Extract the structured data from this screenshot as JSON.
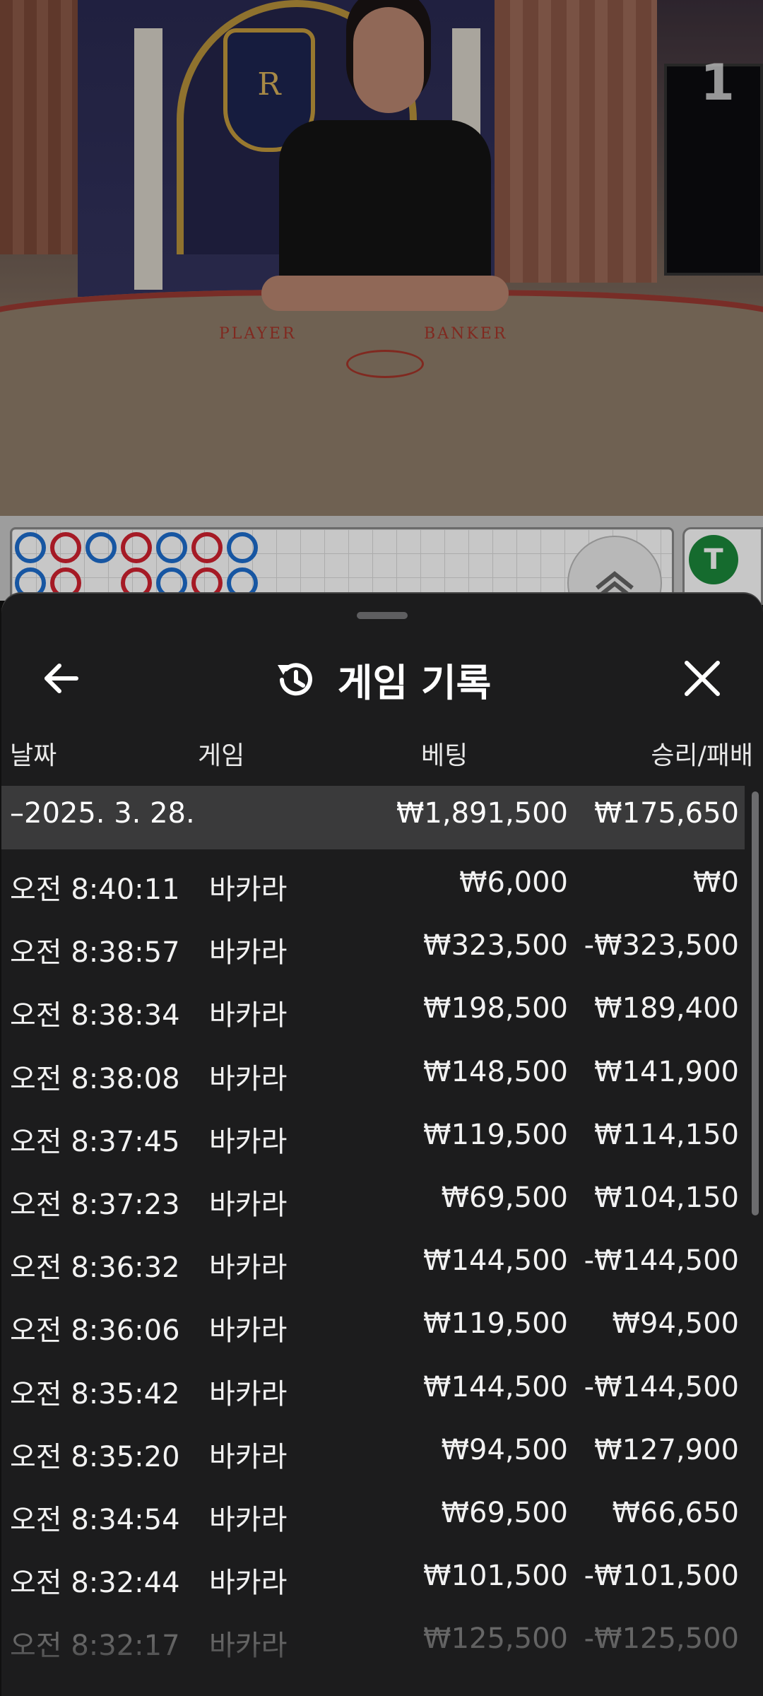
{
  "video": {
    "table_number": "1",
    "table_labels": {
      "player": "PLAYER",
      "banker": "BANKER"
    },
    "crest_letter": "R"
  },
  "road": {
    "side_badge": "T",
    "beads": [
      {
        "col": 0,
        "row": 0,
        "color": "b"
      },
      {
        "col": 1,
        "row": 0,
        "color": "r"
      },
      {
        "col": 2,
        "row": 0,
        "color": "b"
      },
      {
        "col": 3,
        "row": 0,
        "color": "r"
      },
      {
        "col": 4,
        "row": 0,
        "color": "b"
      },
      {
        "col": 5,
        "row": 0,
        "color": "r"
      },
      {
        "col": 6,
        "row": 0,
        "color": "b"
      },
      {
        "col": 0,
        "row": 1,
        "color": "b"
      },
      {
        "col": 1,
        "row": 1,
        "color": "r"
      },
      {
        "col": 3,
        "row": 1,
        "color": "r"
      },
      {
        "col": 4,
        "row": 1,
        "color": "b"
      },
      {
        "col": 5,
        "row": 1,
        "color": "r"
      },
      {
        "col": 6,
        "row": 1,
        "color": "b"
      }
    ]
  },
  "sheet": {
    "title": "게임 기록",
    "back_icon": "arrow-left-icon",
    "history_icon": "history-icon",
    "close_icon": "close-icon",
    "columns": {
      "date": "날짜",
      "game": "게임",
      "bet": "베팅",
      "win_loss": "승리/패배"
    },
    "summary": {
      "date": "–2025. 3. 28.",
      "bet": "₩1,891,500",
      "win_loss": "₩175,650"
    },
    "rows": [
      {
        "time": "오전 8:40:11",
        "game": "바카라",
        "bet": "₩6,000",
        "win_loss": "₩0"
      },
      {
        "time": "오전 8:38:57",
        "game": "바카라",
        "bet": "₩323,500",
        "win_loss": "-₩323,500"
      },
      {
        "time": "오전 8:38:34",
        "game": "바카라",
        "bet": "₩198,500",
        "win_loss": "₩189,400"
      },
      {
        "time": "오전 8:38:08",
        "game": "바카라",
        "bet": "₩148,500",
        "win_loss": "₩141,900"
      },
      {
        "time": "오전 8:37:45",
        "game": "바카라",
        "bet": "₩119,500",
        "win_loss": "₩114,150"
      },
      {
        "time": "오전 8:37:23",
        "game": "바카라",
        "bet": "₩69,500",
        "win_loss": "₩104,150"
      },
      {
        "time": "오전 8:36:32",
        "game": "바카라",
        "bet": "₩144,500",
        "win_loss": "-₩144,500"
      },
      {
        "time": "오전 8:36:06",
        "game": "바카라",
        "bet": "₩119,500",
        "win_loss": "₩94,500"
      },
      {
        "time": "오전 8:35:42",
        "game": "바카라",
        "bet": "₩144,500",
        "win_loss": "-₩144,500"
      },
      {
        "time": "오전 8:35:20",
        "game": "바카라",
        "bet": "₩94,500",
        "win_loss": "₩127,900"
      },
      {
        "time": "오전 8:34:54",
        "game": "바카라",
        "bet": "₩69,500",
        "win_loss": "₩66,650"
      },
      {
        "time": "오전 8:32:44",
        "game": "바카라",
        "bet": "₩101,500",
        "win_loss": "-₩101,500"
      },
      {
        "time": "오전 8:32:17",
        "game": "바카라",
        "bet": "₩125,500",
        "win_loss": "-₩125,500"
      }
    ]
  }
}
